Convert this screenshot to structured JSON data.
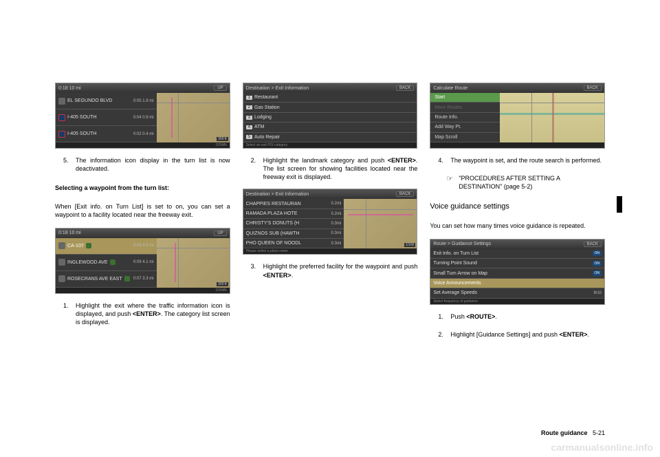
{
  "col1": {
    "screen1": {
      "topbar_left": "0:18    10 mi",
      "topbar_right": "UP",
      "rows": [
        {
          "icon": "arrow",
          "label": "EL SEGUNDO BLVD",
          "meta": "0:05  1.9 mi"
        },
        {
          "icon": "highway",
          "label": "I-405 SOUTH",
          "meta": "0:04  0.9 mi"
        },
        {
          "icon": "highway",
          "label": "I-405 SOUTH",
          "meta": "0:02  0.4 mi"
        }
      ],
      "bottombar": "DOWN",
      "scale": "300 ft"
    },
    "item5": {
      "num": "5.",
      "text": "The information icon display in the turn list is now deactivated."
    },
    "subheading": "Selecting a waypoint from the turn list:",
    "para1": "When [Exit info. on Turn List] is set to on, you can set a waypoint to a facility located near the freeway exit.",
    "screen2": {
      "topbar_left": "0:18    10 mi",
      "topbar_right": "UP",
      "rows": [
        {
          "icon": "arrow",
          "label": "CA-107",
          "meta": "0:09  4.0 mi",
          "highlight": true,
          "info_icon": true
        },
        {
          "icon": "arrow",
          "label": "INGLEWOOD AVE",
          "meta": "0:09  4.1 mi",
          "info_icon": true
        },
        {
          "icon": "arrow",
          "label": "ROSECRANS AVE EAST",
          "meta": "0:07  3.3 mi",
          "info_icon": true
        }
      ],
      "bottombar": "DOWN",
      "scale": "300 ft"
    },
    "item1": {
      "num": "1.",
      "text_a": "Highlight the exit where the traffic information icon is displayed, and push ",
      "text_b": ". The category list screen is displayed.",
      "enter": "<ENTER>"
    }
  },
  "col2": {
    "screen1": {
      "title": "Destination > Exit Information",
      "back": "BACK",
      "rows": [
        {
          "num": "1",
          "label": "Restaurant"
        },
        {
          "num": "2",
          "label": "Gas Station"
        },
        {
          "num": "3",
          "label": "Lodging"
        },
        {
          "num": "4",
          "label": "ATM"
        },
        {
          "num": "5",
          "label": "Auto Repair"
        }
      ],
      "bottombar": "Select an exit POI category"
    },
    "item2": {
      "num": "2.",
      "text_a": "Highlight the landmark category and push ",
      "enter": "<ENTER>",
      "text_b": ". The list screen for showing facilities located near the freeway exit is displayed."
    },
    "screen2": {
      "title": "Destination > Exit Information",
      "back": "BACK",
      "rows": [
        {
          "label": "CHAPPIES RESTAURAN",
          "dist": "0.2mi"
        },
        {
          "label": "RAMADA PLAZA HOTE",
          "dist": "0.2mi"
        },
        {
          "label": "CHRISTY'S DONUTS (H",
          "dist": "0.3mi"
        },
        {
          "label": "QUIZNOS SUB (HAWTH",
          "dist": "0.3mi"
        },
        {
          "label": "PHO QUEEN OF NOODL",
          "dist": "0.3mi"
        }
      ],
      "bottombar": "Please select a place name",
      "counter": "1/100"
    },
    "item3": {
      "num": "3.",
      "text_a": "Highlight the preferred facility for the waypoint and push ",
      "enter": "<ENTER>",
      "text_b": "."
    }
  },
  "col3": {
    "screen1": {
      "title": "Calculate Route",
      "back": "BACK",
      "rows": [
        {
          "label": "Start",
          "cls": "start"
        },
        {
          "label": "More Routes",
          "cls": "dim"
        },
        {
          "label": "Route Info."
        },
        {
          "label": "Add Way Pt."
        },
        {
          "label": "Map Scroll"
        }
      ],
      "bottombar": ""
    },
    "item4": {
      "num": "4.",
      "text": "The waypoint is set, and the route search is performed."
    },
    "ref": {
      "text": "\"PROCEDURES AFTER SETTING A DESTINATION\" (page 5-2)"
    },
    "heading": "Voice guidance settings",
    "para": "You can set how many times voice guidance is repeated.",
    "screen2": {
      "title": "Route > Guidance Settings",
      "back": "BACK",
      "rows": [
        {
          "label": "Exit Info. on Turn List",
          "toggle": "ON"
        },
        {
          "label": "Turning Point Sound",
          "toggle": "ON"
        },
        {
          "label": "Small Turn Arrow on Map",
          "toggle": "ON"
        },
        {
          "label": "Voice Announcements",
          "highlight": true
        },
        {
          "label": "Set Average Speeds"
        }
      ],
      "bottombar": "Select frequency of guidance",
      "counter": "9/10"
    },
    "item1": {
      "num": "1.",
      "text_a": "Push ",
      "route": "<ROUTE>",
      "text_b": "."
    },
    "item2b": {
      "num": "2.",
      "text_a": "Highlight [Guidance Settings] and push ",
      "enter": "<ENTER>",
      "text_b": "."
    }
  },
  "footer": {
    "section": "Route guidance",
    "page": "5-21"
  },
  "watermark": "carmanualsonline.info"
}
